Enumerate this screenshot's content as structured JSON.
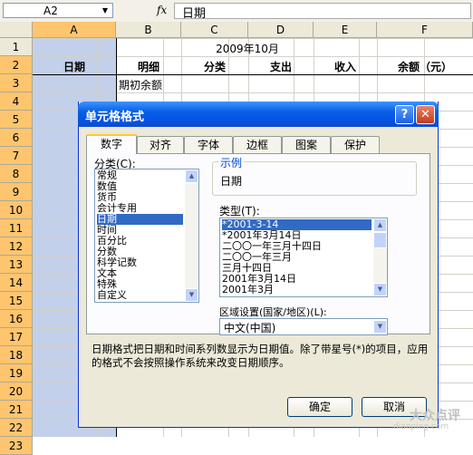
{
  "formula_bar": {
    "name_box": "A2",
    "fx": "fx",
    "content": "日期"
  },
  "columns": [
    "A",
    "B",
    "C",
    "D",
    "E",
    "F"
  ],
  "rows": [
    "1",
    "2",
    "3",
    "4",
    "5",
    "6",
    "7",
    "8",
    "9",
    "10",
    "11",
    "12",
    "13",
    "14",
    "15",
    "16",
    "17",
    "18",
    "19",
    "20",
    "21",
    "22",
    "23"
  ],
  "sheet": {
    "title": "2009年10月",
    "headers": [
      "日期",
      "明细",
      "分类",
      "支出",
      "收入",
      "余额（元）"
    ],
    "row3_b": "期初余额"
  },
  "dialog": {
    "title": "单元格格式",
    "help": "?",
    "close": "✕",
    "tabs": [
      "数字",
      "对齐",
      "字体",
      "边框",
      "图案",
      "保护"
    ],
    "category_label": "分类(C):",
    "categories": [
      "常规",
      "数值",
      "货币",
      "会计专用",
      "日期",
      "时间",
      "百分比",
      "分数",
      "科学记数",
      "文本",
      "特殊",
      "自定义"
    ],
    "selected_category": "日期",
    "sample_label": "示例",
    "sample_value": "日期",
    "type_label": "类型(T):",
    "types": [
      "*2001-3-14",
      "*2001年3月14日",
      "二〇〇一年三月十四日",
      "二〇〇一年三月",
      "三月十四日",
      "2001年3月14日",
      "2001年3月"
    ],
    "selected_type": "*2001-3-14",
    "locale_label": "区域设置(国家/地区)(L):",
    "locale_value": "中文(中国)",
    "description": "日期格式把日期和时间系列数显示为日期值。除了带星号(*)的项目，应用的格式不会按照操作系统来改变日期顺序。",
    "ok": "确定",
    "cancel": "取消"
  },
  "watermark": {
    "main": "大众点评",
    "sub": "dianping.com"
  }
}
